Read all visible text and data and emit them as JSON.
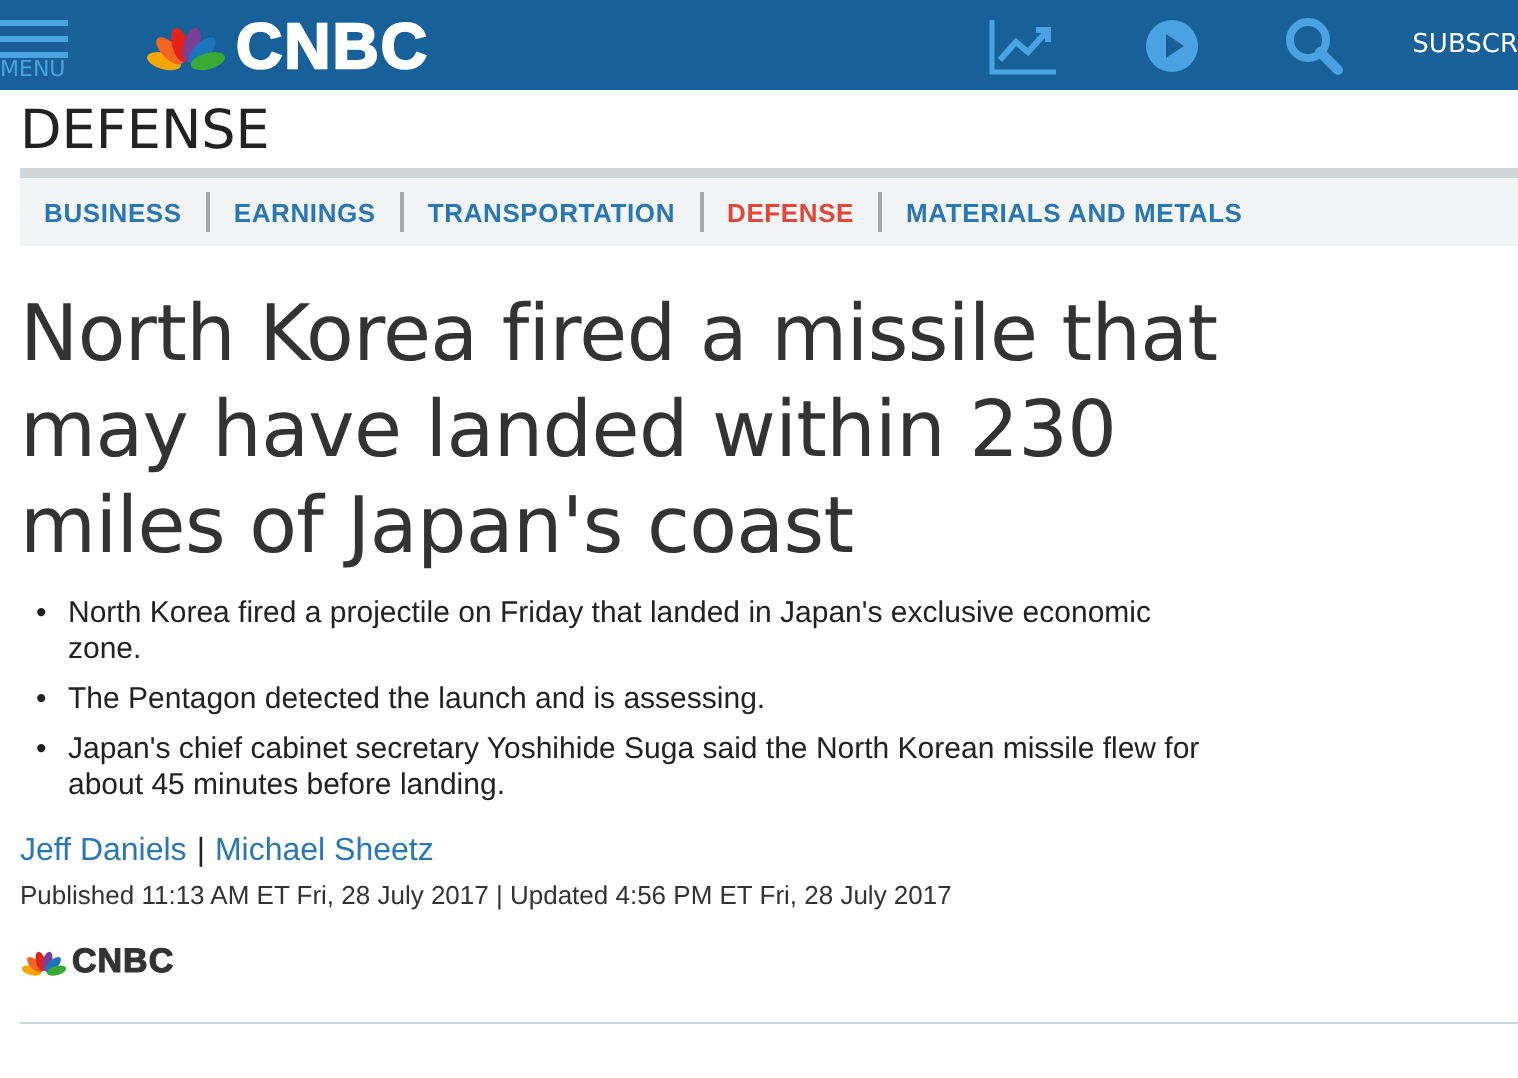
{
  "header": {
    "menu_label": "MENU",
    "logo_text": "CNBC",
    "subscribe_label": "SUBSCR"
  },
  "section_title": "DEFENSE",
  "tabs": [
    {
      "label": "BUSINESS",
      "selected": false
    },
    {
      "label": "EARNINGS",
      "selected": false
    },
    {
      "label": "TRANSPORTATION",
      "selected": false
    },
    {
      "label": "DEFENSE",
      "selected": true
    },
    {
      "label": "MATERIALS AND METALS",
      "selected": false
    }
  ],
  "headline": "North Korea fired a missile that may have landed within 230 miles of Japan's coast",
  "bullet_marker": "•",
  "bullets": [
    "North Korea fired a projectile on Friday that landed in Japan's exclusive economic zone.",
    "The Pentagon detected the launch and is assessing.",
    "Japan's chief cabinet secretary Yoshihide Suga said the North Korean missile flew for about 45 minutes before landing."
  ],
  "authors": [
    "Jeff Daniels",
    "Michael Sheetz"
  ],
  "author_separator": "|",
  "dateline": "Published 11:13 AM ET Fri, 28 July 2017 | Updated 4:56 PM ET Fri, 28 July 2017",
  "source_logo_text": "CNBC"
}
